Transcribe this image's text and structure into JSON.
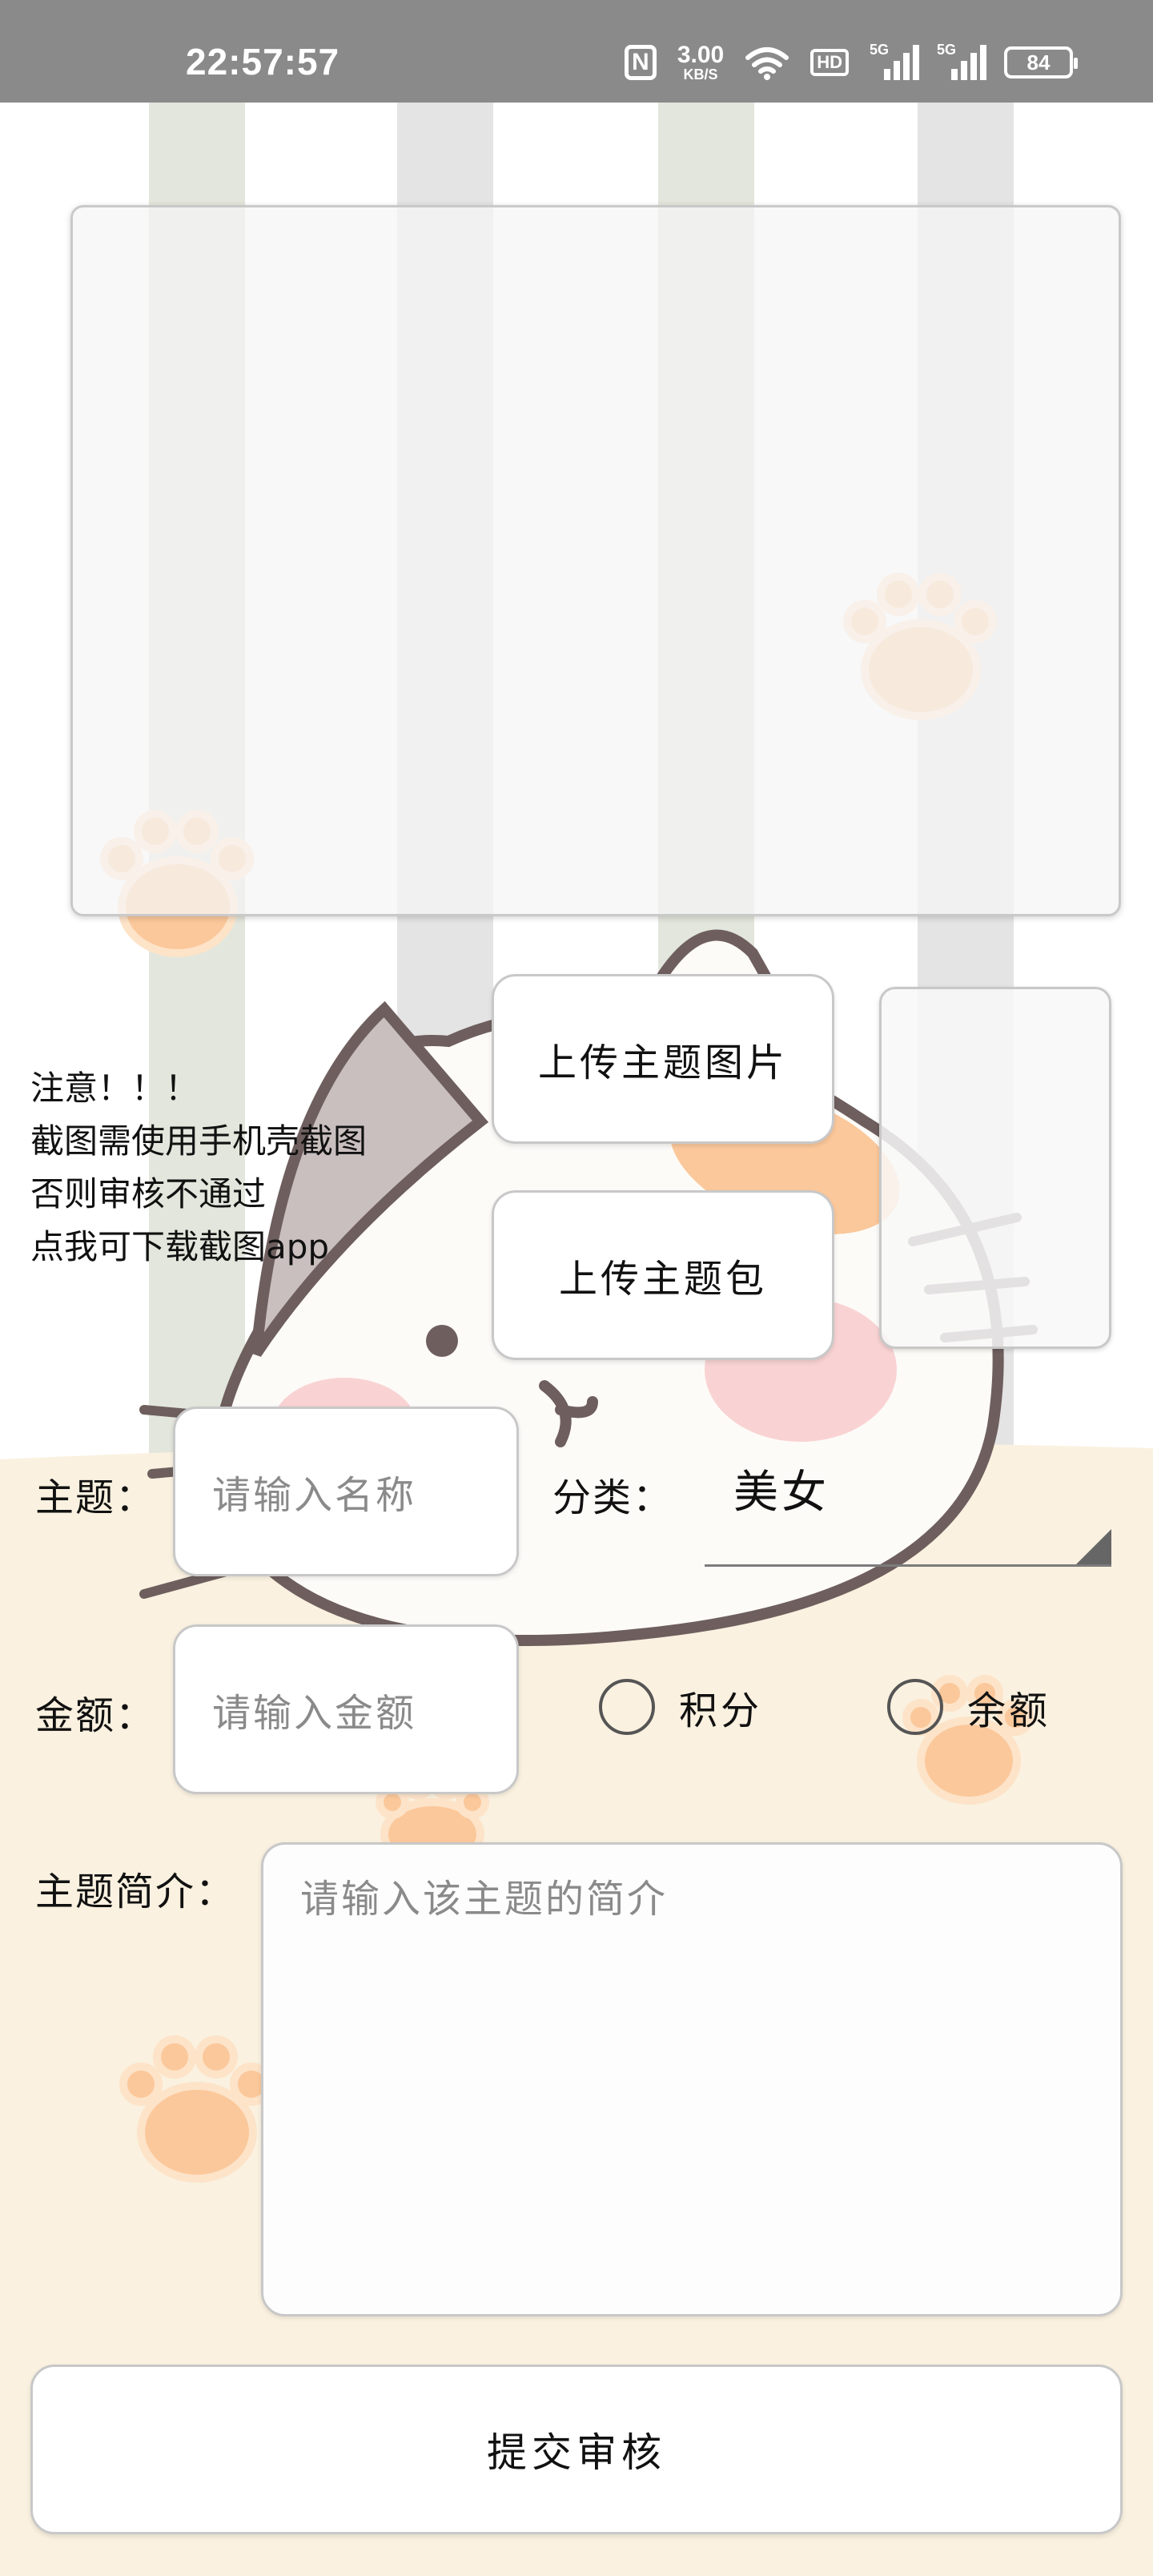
{
  "status_bar": {
    "time": "22:57:57",
    "nfc": "N",
    "net_speed_value": "3.00",
    "net_speed_unit": "KB/S",
    "hd_label": "HD",
    "signal_1_label": "5G",
    "signal_2_label": "5G",
    "battery": "84"
  },
  "upload": {
    "image_button": "上传主题图片",
    "package_button": "上传主题包"
  },
  "notice": {
    "line1": "注意！！！",
    "line2": "截图需使用手机壳截图",
    "line3": "否则审核不通过",
    "line4": "点我可下载截图app"
  },
  "form": {
    "theme_label": "主题：",
    "theme_placeholder": "请输入名称",
    "category_label": "分类：",
    "category_value": "美女",
    "amount_label": "金额：",
    "amount_placeholder": "请输入金额",
    "radio_points": "积分",
    "radio_balance": "余额",
    "intro_label": "主题简介：",
    "intro_placeholder": "请输入该主题的简介",
    "submit": "提交审核"
  },
  "colors": {
    "status_bar": "#8a8a8a",
    "stripe_green": "#e3e6dc",
    "stripe_gray": "#e4e4e4",
    "bottom_cream": "#faf1e0",
    "paw_orange": "#fbc89b",
    "cat_outline": "#6e5f5e"
  },
  "icons": [
    "nfc-icon",
    "wifi-icon",
    "hd-icon",
    "signal-icon",
    "battery-icon",
    "paw-icon",
    "cat-illustration"
  ]
}
